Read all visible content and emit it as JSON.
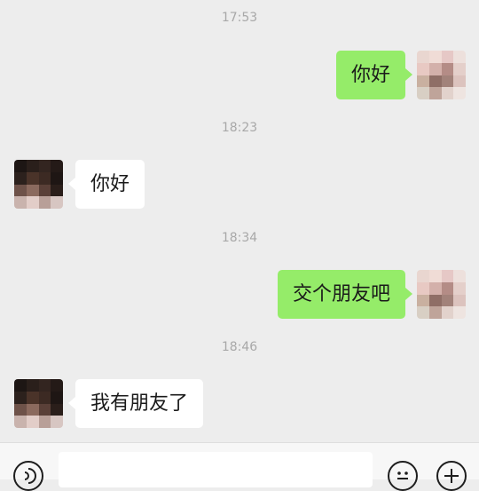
{
  "messages": [
    {
      "time": "17:53",
      "direction": "out",
      "text": "你好"
    },
    {
      "time": "18:23",
      "direction": "in",
      "text": "你好"
    },
    {
      "time": "18:34",
      "direction": "out",
      "text": "交个朋友吧"
    },
    {
      "time": "18:46",
      "direction": "in",
      "text": "我有朋友了"
    }
  ],
  "input": {
    "value": "",
    "placeholder": ""
  },
  "icons": {
    "voice": "voice-icon",
    "emoji": "emoji-icon",
    "more": "plus-icon"
  },
  "colors": {
    "background": "#ededed",
    "outgoing_bubble": "#95ec69",
    "incoming_bubble": "#ffffff",
    "timestamp": "#a8a8a8"
  }
}
